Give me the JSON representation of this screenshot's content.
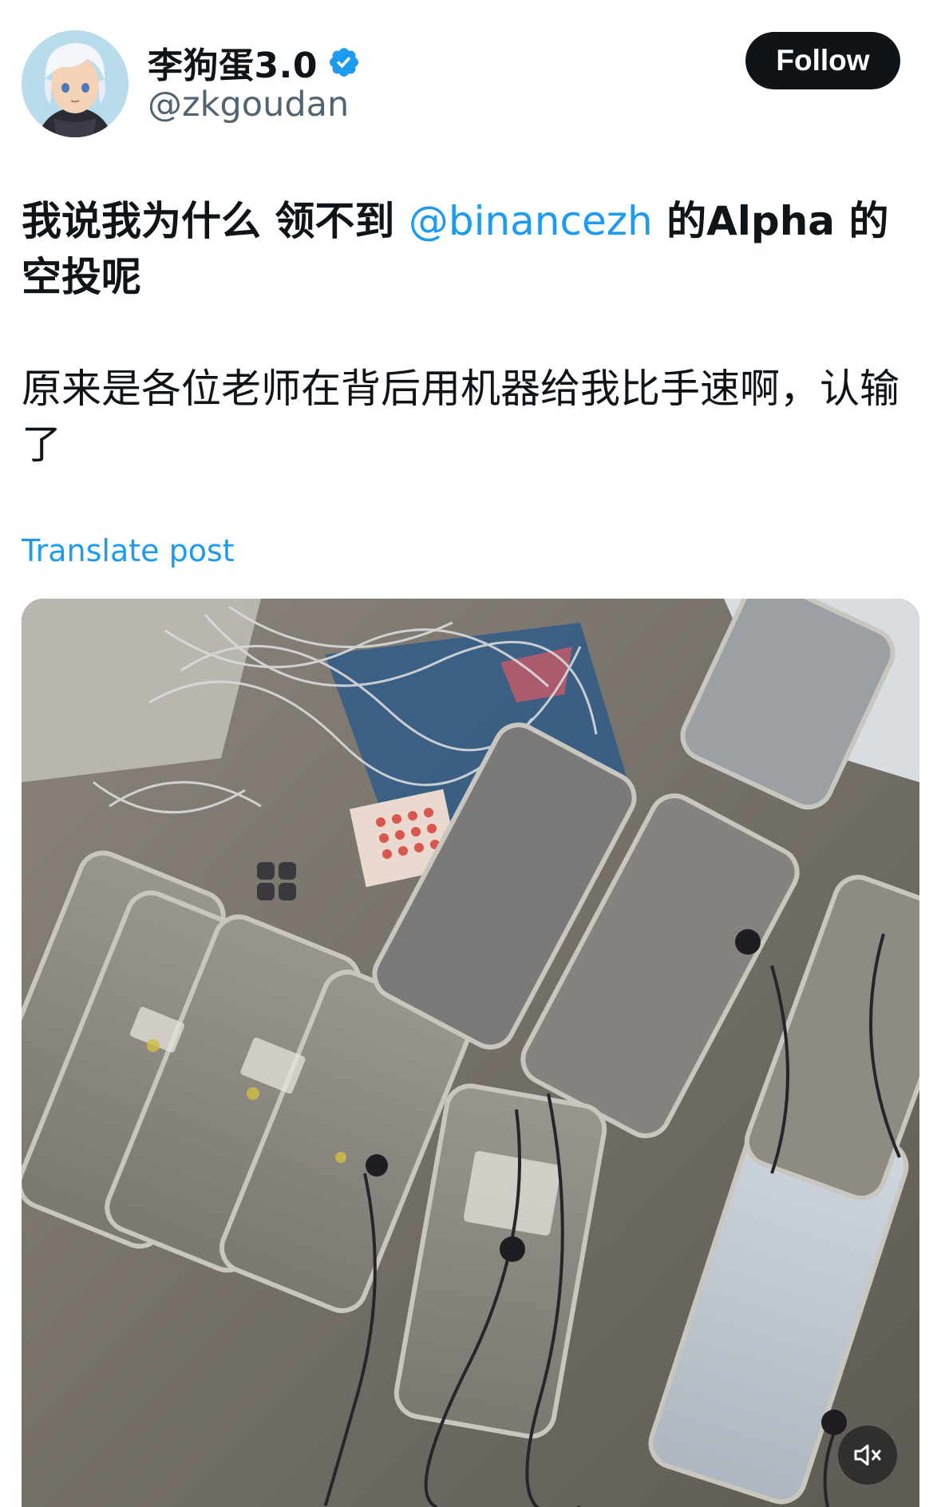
{
  "author": {
    "display_name": "李狗蛋3.0",
    "handle": "@zkgoudan",
    "verified_icon": "verified-badge-icon",
    "avatar_icon": "anime-avatar-icon"
  },
  "follow": {
    "label": "Follow"
  },
  "post": {
    "line1_prefix": "我说我为什么 领不到 ",
    "mention": "@binancezh",
    "line1_suffix": " 的Alpha 的空投呢",
    "line2": "原来是各位老师在背后用机器给我比手速啊，认输了"
  },
  "translate": {
    "label": "Translate post"
  },
  "media": {
    "kind": "video",
    "mute_icon": "speaker-muted-icon"
  },
  "colors": {
    "accent": "#1d9bf0",
    "text": "#0f1419",
    "muted": "#536471",
    "button": "#0f1419"
  }
}
